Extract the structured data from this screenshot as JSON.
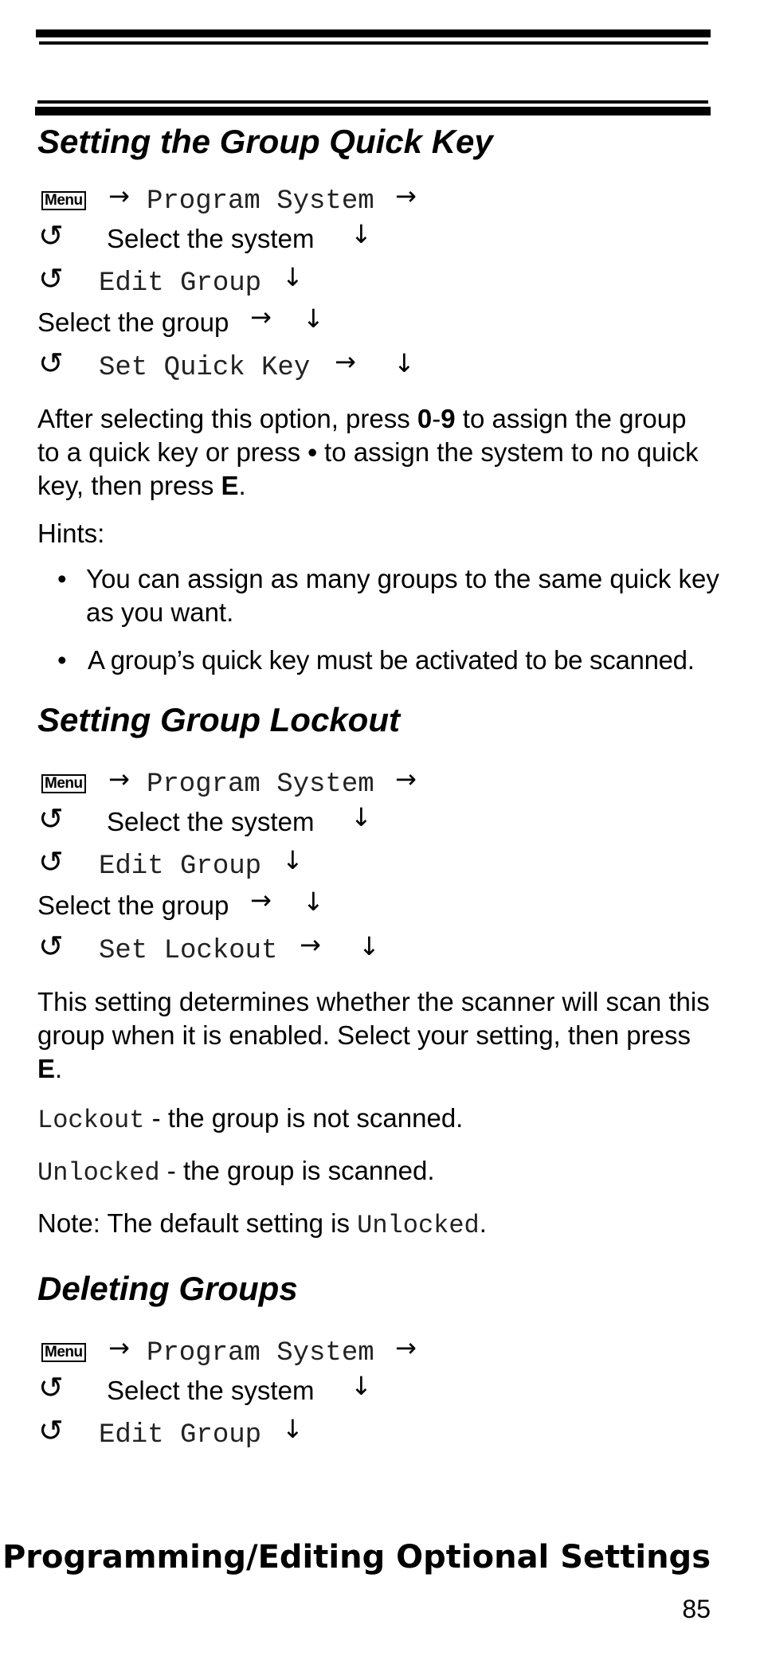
{
  "sections": [
    {
      "title": "Setting the Group Quick Key",
      "steps": {
        "menu_key": "Menu",
        "program_system": "Program System",
        "select_system": "Select the system",
        "edit_group": "Edit Group",
        "select_group": "Select the group",
        "final_option": "Set Quick Key"
      },
      "paragraph": {
        "part1": "After selecting this option, press ",
        "key_0": "0",
        "dash": "-",
        "key_9": "9",
        "part2": " to assign the group to a quick key or press ",
        "dot_key": "•",
        "part3": " to assign the system to no quick key, then press ",
        "key_e": "E",
        "part4": "."
      },
      "hints_label": "Hints:",
      "hints": [
        "You can assign as many groups to the same quick key as you want.",
        "A group’s quick key must be activated to be scanned."
      ]
    },
    {
      "title": "Setting Group Lockout",
      "steps": {
        "menu_key": "Menu",
        "program_system": "Program System",
        "select_system": "Select the system",
        "edit_group": "Edit Group",
        "select_group": "Select the group",
        "final_option": "Set Lockout"
      },
      "paragraph": {
        "part1": "This setting determines whether the scanner will scan this group when it is enabled. Select your setting, then press ",
        "key_e": "E",
        "part2": "."
      },
      "options": [
        {
          "value": "Lockout",
          "description": " - the group is not scanned."
        },
        {
          "value": "Unlocked",
          "description": " - the group is scanned."
        }
      ],
      "note": {
        "prefix": "Note: The default setting is ",
        "value": "Unlocked",
        "suffix": "."
      }
    },
    {
      "title": "Deleting Groups",
      "steps": {
        "menu_key": "Menu",
        "program_system": "Program System",
        "select_system": "Select the system",
        "edit_group": "Edit Group"
      }
    }
  ],
  "icons": {
    "right_arrow": "→",
    "down_arrow": "↓",
    "rotate": "↺"
  },
  "footer": {
    "chapter_title": "Programming/Editing Optional Settings",
    "page_number": "85"
  }
}
